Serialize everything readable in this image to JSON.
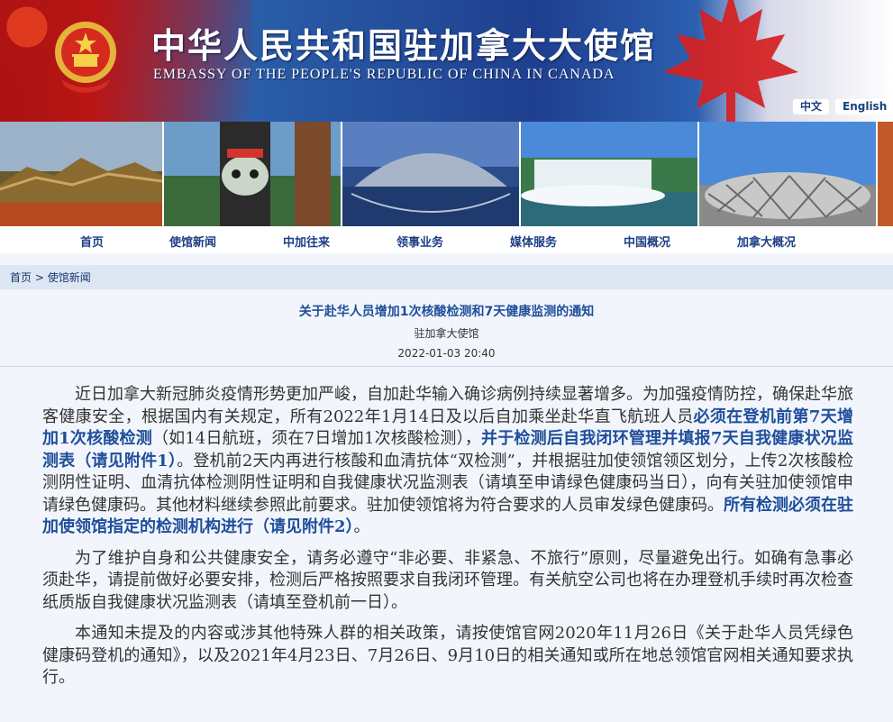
{
  "header": {
    "title": "中华人民共和国驻加拿大大使馆",
    "subtitle": "EMBASSY OF THE PEOPLE'S REPUBLIC OF CHINA IN CANADA",
    "lang_zh": "中文",
    "lang_en": "English"
  },
  "nav": {
    "items": [
      "首页",
      "使馆新闻",
      "中加往来",
      "领事业务",
      "媒体服务",
      "中国概况",
      "加拿大概况"
    ]
  },
  "breadcrumb": {
    "home": "首页",
    "sep": ">",
    "current": "使馆新闻"
  },
  "article": {
    "title": "关于赴华人员增加1次核酸检测和7天健康监测的通知",
    "source": "驻加拿大使馆",
    "date": "2022-01-03 20:40",
    "p1_a": "近日加拿大新冠肺炎疫情形势更加严峻，自加赴华输入确诊病例持续显著增多。为加强疫情防控，确保赴华旅客健康安全，根据国内有关规定，所有2022年1月14日及以后自加乘坐赴华直飞航班人员",
    "p1_b": "必须在登机前第7天增加1次核酸检测",
    "p1_c": "（如14日航班，须在7日增加1次核酸检测），",
    "p1_d": "并于检测后自我闭环管理并填报7天自我健康状况监测表（请见附件1）",
    "p1_e": "。登机前2天内再进行核酸和血清抗体“双检测”，并根据驻加使领馆领区划分，上传2次核酸检测阴性证明、血清抗体检测阴性证明和自我健康状况监测表（请填至申请绿色健康码当日），向有关驻加使领馆申请绿色健康码。其他材料继续参照此前要求。驻加使领馆将为符合要求的人员审发绿色健康码。",
    "p1_f": "所有检测必须在驻加使领馆指定的检测机构进行（请见附件2）",
    "p1_g": "。",
    "p2": "为了维护自身和公共健康安全，请务必遵守“非必要、非紧急、不旅行”原则，尽量避免出行。如确有急事必须赴华，请提前做好必要安排，检测后严格按照要求自我闭环管理。有关航空公司也将在办理登机手续时再次检查纸质版自我健康状况监测表（请填至登机前一日）。",
    "p3": "本通知未提及的内容或涉其他特殊人群的相关政策，请按使馆官网2020年11月26日《关于赴华人员凭绿色健康码登机的通知》，以及2021年4月23日、7月26日、9月10日的相关通知或所在地总领馆官网相关通知要求执行。"
  },
  "icons": {
    "emblem": "national-emblem-icon",
    "leaf": "maple-leaf-icon"
  },
  "colors": {
    "link_blue": "#1f4e9b",
    "nav_blue": "#1d3f86",
    "header_red": "#c01515"
  }
}
